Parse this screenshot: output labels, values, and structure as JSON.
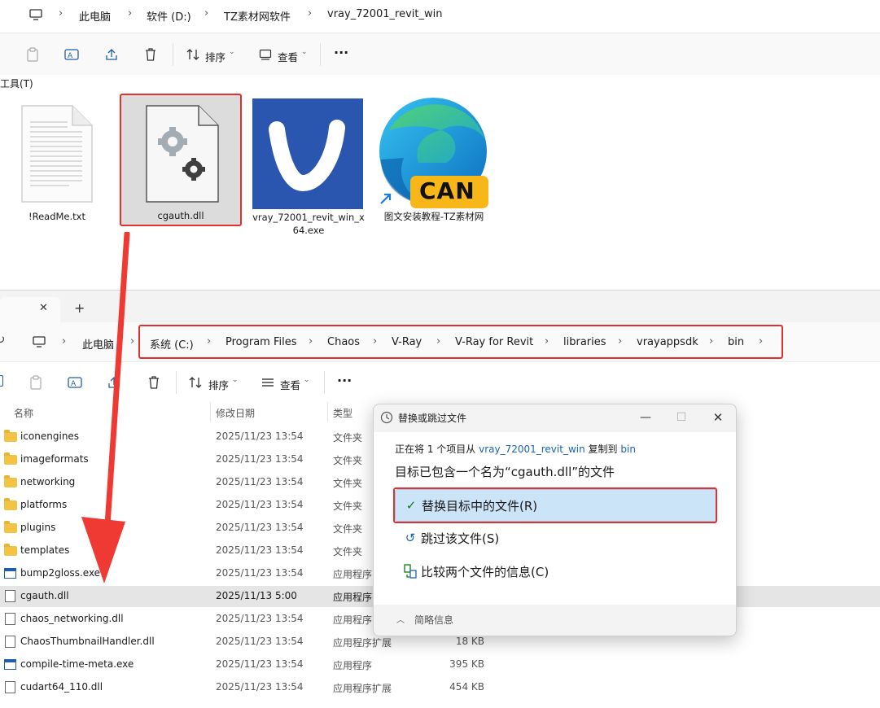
{
  "top_window": {
    "breadcrumbs": [
      "此电脑",
      "软件 (D:)",
      "TZ素材网软件",
      "vray_72001_revit_win"
    ],
    "toolbar": {
      "sort_label": "排序",
      "view_label": "查看",
      "more_label": "···"
    },
    "tools_label": "工具(T)",
    "files": [
      {
        "name": "!ReadMe.txt",
        "icon": "text-document-icon"
      },
      {
        "name": "cgauth.dll",
        "icon": "dll-gear-icon",
        "highlighted": true
      },
      {
        "name_line1": "vray_72001_revit_win_x",
        "name_line2": "64.exe",
        "icon": "vray-logo-icon"
      },
      {
        "name": "图文安装教程-TZ素材网",
        "icon": "edge-shortcut-icon",
        "badge": "CAN"
      }
    ]
  },
  "bottom_window": {
    "tab_close": "✕",
    "tab_add": "+",
    "breadcrumbs": [
      "此电脑",
      "系统 (C:)",
      "Program Files",
      "Chaos",
      "V-Ray",
      "V-Ray for Revit",
      "libraries",
      "vrayappsdk",
      "bin"
    ],
    "toolbar": {
      "sort_label": "排序",
      "view_label": "查看",
      "more_label": "···"
    },
    "columns": [
      "名称",
      "修改日期",
      "类型"
    ],
    "rows": [
      {
        "name": "iconengines",
        "date": "2025/11/23 13:54",
        "type": "文件夹",
        "size": "",
        "kind": "folder"
      },
      {
        "name": "imageformats",
        "date": "2025/11/23 13:54",
        "type": "文件夹",
        "size": "",
        "kind": "folder"
      },
      {
        "name": "networking",
        "date": "2025/11/23 13:54",
        "type": "文件夹",
        "size": "",
        "kind": "folder"
      },
      {
        "name": "platforms",
        "date": "2025/11/23 13:54",
        "type": "文件夹",
        "size": "",
        "kind": "folder"
      },
      {
        "name": "plugins",
        "date": "2025/11/23 13:54",
        "type": "文件夹",
        "size": "",
        "kind": "folder"
      },
      {
        "name": "templates",
        "date": "2025/11/23 13:54",
        "type": "文件夹",
        "size": "",
        "kind": "folder"
      },
      {
        "name": "bump2gloss.exe",
        "date": "2025/11/23 13:54",
        "type": "应用程序",
        "size": "",
        "kind": "exe"
      },
      {
        "name": "cgauth.dll",
        "date": "2025/11/13 5:00",
        "type": "应用程序",
        "size": "",
        "kind": "dll",
        "selected": true
      },
      {
        "name": "chaos_networking.dll",
        "date": "2025/11/23 13:54",
        "type": "应用程序",
        "size": "",
        "kind": "dll"
      },
      {
        "name": "ChaosThumbnailHandler.dll",
        "date": "2025/11/23 13:54",
        "type": "应用程序扩展",
        "size": "18 KB",
        "kind": "dll"
      },
      {
        "name": "compile-time-meta.exe",
        "date": "2025/11/23 13:54",
        "type": "应用程序",
        "size": "395 KB",
        "kind": "exe"
      },
      {
        "name": "cudart64_110.dll",
        "date": "2025/11/23 13:54",
        "type": "应用程序扩展",
        "size": "454 KB",
        "kind": "dll"
      }
    ]
  },
  "dialog": {
    "title": "替换或跳过文件",
    "info_prefix": "正在将 1 个项目从",
    "info_source": "vray_72001_revit_win",
    "info_mid": "复制到",
    "info_dest": "bin",
    "heading": "目标已包含一个名为“cgauth.dll”的文件",
    "options": [
      {
        "label": "替换目标中的文件(R)",
        "icon": "checkmark-icon"
      },
      {
        "label": "跳过该文件(S)",
        "icon": "skip-undo-icon"
      },
      {
        "label": "比较两个文件的信息(C)",
        "icon": "compare-icon"
      }
    ],
    "footer": "简略信息"
  },
  "colors": {
    "highlight_red": "#e0312c",
    "annotation_arrow": "#ee3a33",
    "accent_blue": "#1763b8",
    "vray_blue": "#2b56b0",
    "can_badge": "#f7b718"
  }
}
